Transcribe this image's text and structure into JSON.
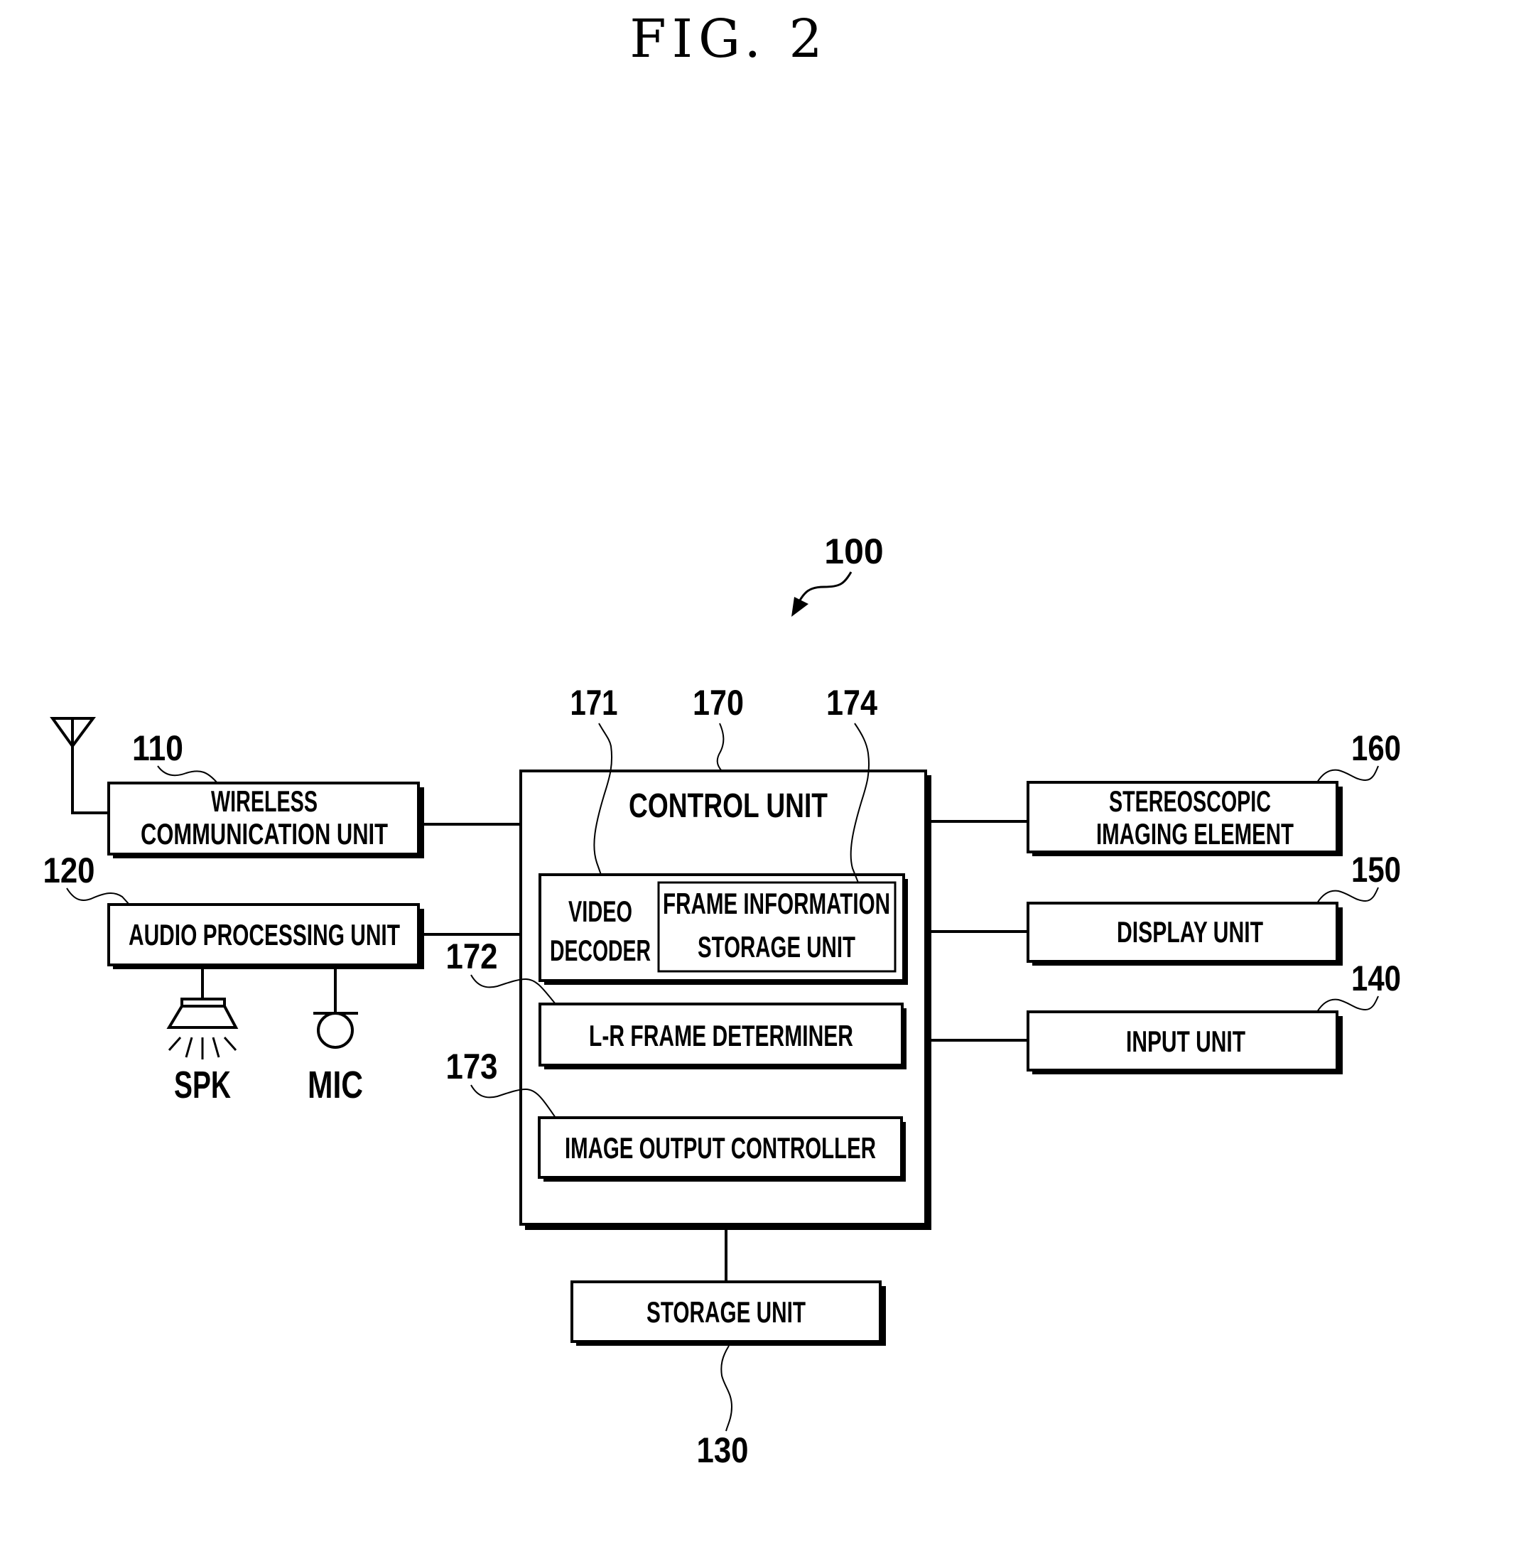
{
  "figure": {
    "title": "FIG. 2",
    "device_ref": "100"
  },
  "colors": {
    "line": "#000000",
    "background": "#ffffff"
  },
  "blocks": {
    "wireless": {
      "ref": "110",
      "line1": "WIRELESS",
      "line2": "COMMUNICATION UNIT"
    },
    "audio": {
      "ref": "120",
      "label": "AUDIO PROCESSING UNIT"
    },
    "storage": {
      "ref": "130",
      "label": "STORAGE UNIT"
    },
    "input": {
      "ref": "140",
      "label": "INPUT UNIT"
    },
    "display": {
      "ref": "150",
      "label": "DISPLAY UNIT"
    },
    "stereo": {
      "ref": "160",
      "line1": "STEREOSCOPIC",
      "line2": "IMAGING ELEMENT"
    },
    "control": {
      "ref": "170",
      "label": "CONTROL UNIT"
    },
    "video_decoder": {
      "ref": "171",
      "line1": "VIDEO",
      "line2": "DECODER"
    },
    "lr_determiner": {
      "ref": "172",
      "label": "L-R FRAME DETERMINER"
    },
    "image_output": {
      "ref": "173",
      "label": "IMAGE OUTPUT CONTROLLER"
    },
    "frame_info": {
      "ref": "174",
      "line1": "FRAME INFORMATION",
      "line2": "STORAGE UNIT"
    }
  },
  "peripherals": {
    "speaker": {
      "label": "SPK",
      "icon": "speaker-icon"
    },
    "microphone": {
      "label": "MIC",
      "icon": "microphone-icon"
    },
    "antenna": {
      "icon": "antenna-icon"
    }
  }
}
